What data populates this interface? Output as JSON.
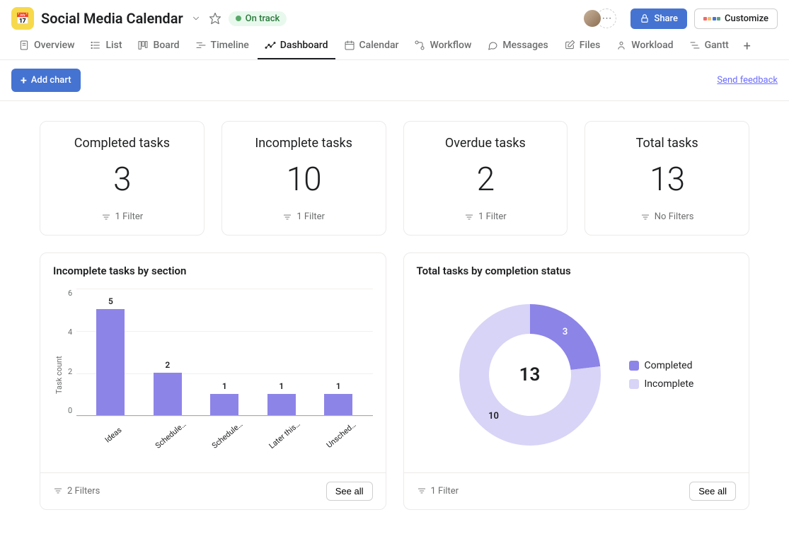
{
  "header": {
    "project_title": "Social Media Calendar",
    "status_label": "On track",
    "share_label": "Share",
    "customize_label": "Customize"
  },
  "tabs": [
    {
      "id": "overview",
      "label": "Overview"
    },
    {
      "id": "list",
      "label": "List"
    },
    {
      "id": "board",
      "label": "Board"
    },
    {
      "id": "timeline",
      "label": "Timeline"
    },
    {
      "id": "dashboard",
      "label": "Dashboard",
      "active": true
    },
    {
      "id": "calendar",
      "label": "Calendar"
    },
    {
      "id": "workflow",
      "label": "Workflow"
    },
    {
      "id": "messages",
      "label": "Messages"
    },
    {
      "id": "files",
      "label": "Files"
    },
    {
      "id": "workload",
      "label": "Workload"
    },
    {
      "id": "gantt",
      "label": "Gantt"
    }
  ],
  "toolbar": {
    "add_chart_label": "Add chart",
    "feedback_label": "Send feedback"
  },
  "summary_cards": [
    {
      "title": "Completed tasks",
      "value": "3",
      "filter": "1 Filter"
    },
    {
      "title": "Incomplete tasks",
      "value": "10",
      "filter": "1 Filter"
    },
    {
      "title": "Overdue tasks",
      "value": "2",
      "filter": "1 Filter"
    },
    {
      "title": "Total tasks",
      "value": "13",
      "filter": "No Filters"
    }
  ],
  "bar_chart": {
    "title": "Incomplete tasks by section",
    "filter": "2 Filters",
    "see_all": "See all",
    "ylabel": "Task count"
  },
  "donut_chart": {
    "title": "Total tasks by completion status",
    "filter": "1 Filter",
    "see_all": "See all",
    "center": "13",
    "legend": {
      "completed": "Completed",
      "incomplete": "Incomplete"
    }
  },
  "chart_data": [
    {
      "type": "bar",
      "title": "Incomplete tasks by section",
      "ylabel": "Task count",
      "ylim": [
        0,
        6
      ],
      "yticks": [
        0,
        2,
        4,
        6
      ],
      "categories": [
        "Ideas",
        "Schedule…",
        "Schedule…",
        "Later this…",
        "Unsched…"
      ],
      "values": [
        5,
        2,
        1,
        1,
        1
      ],
      "color": "#8d84e8"
    },
    {
      "type": "pie",
      "title": "Total tasks by completion status",
      "series": [
        {
          "name": "Completed",
          "value": 3,
          "color": "#8d84e8"
        },
        {
          "name": "Incomplete",
          "value": 10,
          "color": "#d8d4f7"
        }
      ],
      "total": 13
    }
  ]
}
